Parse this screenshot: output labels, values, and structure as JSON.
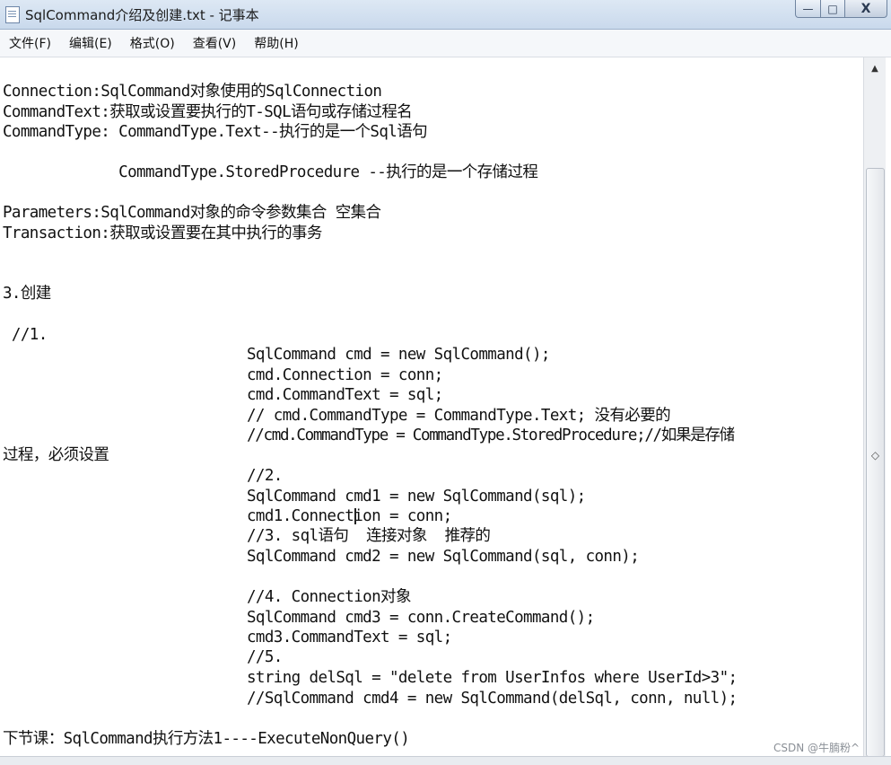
{
  "window": {
    "title": "SqlCommand介绍及创建.txt - 记事本",
    "controls": {
      "minimize": "—",
      "maximize": "□",
      "close": "X"
    }
  },
  "menu": [
    {
      "label": "文件(F)"
    },
    {
      "label": "编辑(E)"
    },
    {
      "label": "格式(O)"
    },
    {
      "label": "查看(V)"
    },
    {
      "label": "帮助(H)"
    }
  ],
  "editor": {
    "lines": [
      "Connection:SqlCommand对象使用的SqlConnection",
      "CommandText:获取或设置要执行的T-SQL语句或存储过程名",
      "CommandType: CommandType.Text--执行的是一个Sql语句",
      "             CommandType.StoredProcedure --执行的是一个存储过程",
      "Parameters:SqlCommand对象的命令参数集合 空集合",
      "Transaction:获取或设置要在其中执行的事务",
      "3.创建",
      " //1.",
      "SqlCommand cmd = new SqlCommand();",
      "cmd.Connection = conn;",
      "cmd.CommandText = sql;",
      "// cmd.CommandType = CommandType.Text; 没有必要的",
      "//cmd.CommandType = CommandType.StoredProcedure;//如果是存储",
      "过程，必须设置",
      "//2.",
      "SqlCommand cmd1 = new SqlCommand(sql);",
      "cmd1.Connection = conn;",
      "//3. sql语句  连接对象  推荐的",
      "SqlCommand cmd2 = new SqlCommand(sql, conn);",
      "//4. Connection对象",
      "SqlCommand cmd3 = conn.CreateCommand();",
      "cmd3.CommandText = sql;",
      "//5.",
      "string delSql = \"delete from UserInfos where UserId>3\";",
      "//SqlCommand cmd4 = new SqlCommand(delSql, conn, null);",
      "下节课：SqlCommand执行方法1----ExecuteNonQuery()"
    ]
  },
  "scrollbar": {
    "up_arrow": "▲",
    "grip": "◇"
  },
  "watermark": "CSDN @牛腩粉^"
}
